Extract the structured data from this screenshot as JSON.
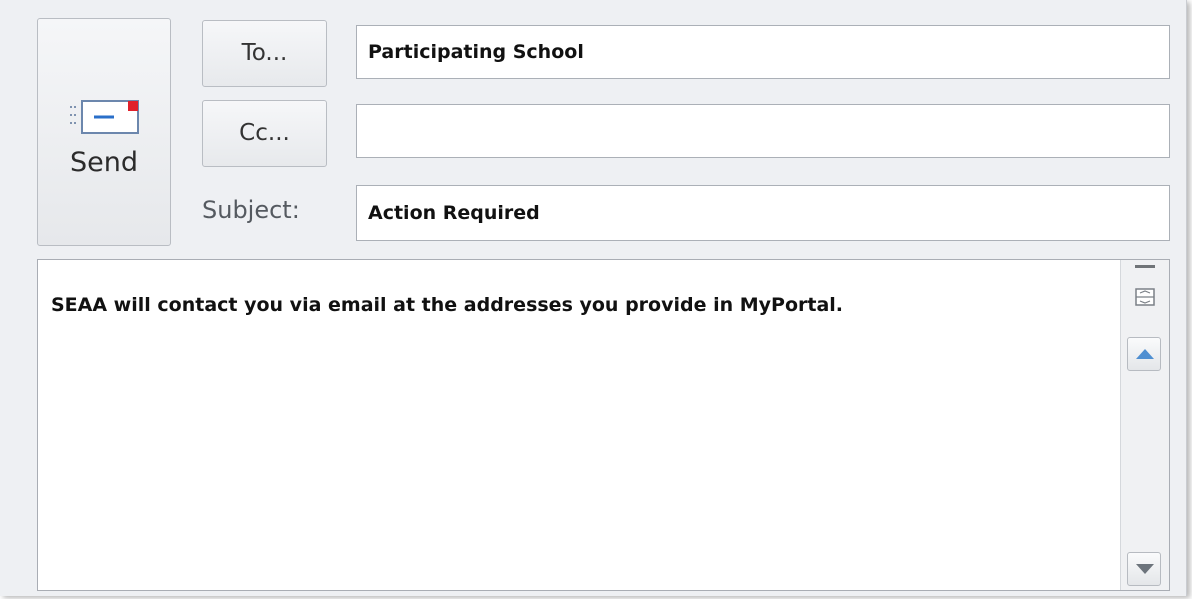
{
  "toolbar": {
    "send_label": "Send",
    "send_icon": "envelope-send-icon"
  },
  "recipients": {
    "to_label": "To...",
    "to_value": "Participating School",
    "cc_label": "Cc...",
    "cc_value": "",
    "subject_label": "Subject:",
    "subject_value": "Action Required"
  },
  "message": {
    "body": "SEAA will contact you via email at the addresses you provide in MyPortal."
  },
  "scrollbar": {
    "split_icon": "split-view-icon",
    "up_icon": "arrow-up-icon",
    "down_icon": "arrow-down-icon"
  },
  "colors": {
    "envelope_accent": "#e0202a",
    "envelope_blue": "#2a6fc9"
  }
}
